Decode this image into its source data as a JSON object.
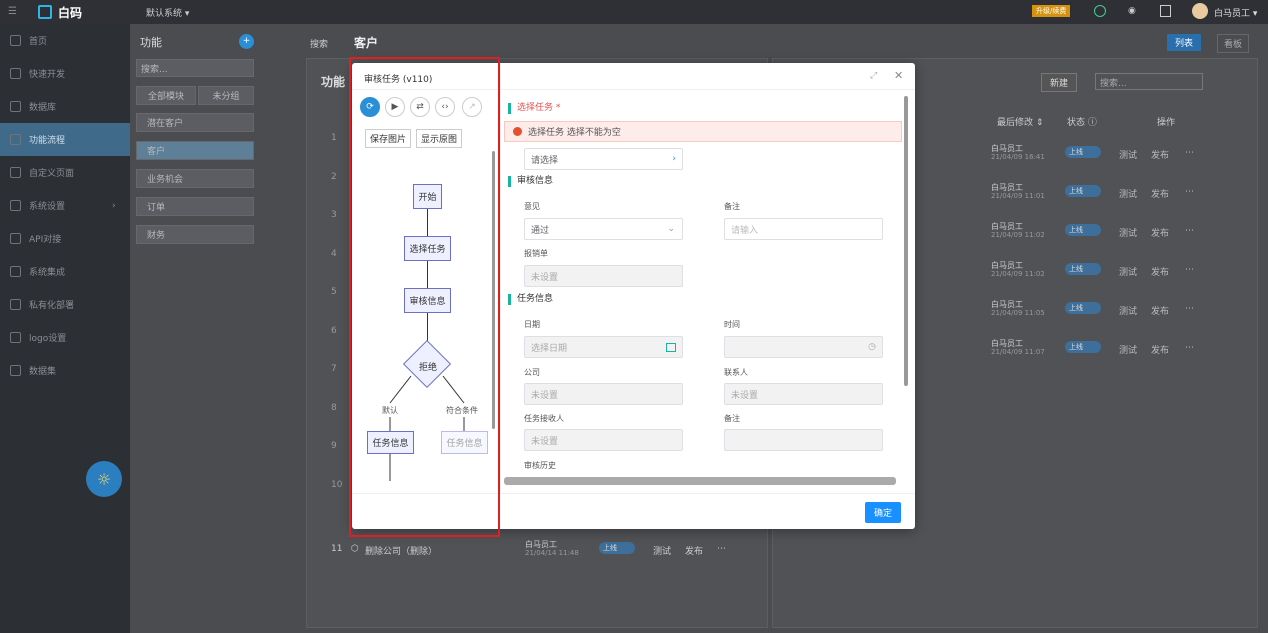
{
  "topbar": {
    "logo": "白码",
    "system": "默认系统 ▾",
    "upgrade": "升级/续费",
    "user": "白马员工 ▾"
  },
  "sidebar": {
    "items": [
      {
        "label": "首页"
      },
      {
        "label": "快速开发"
      },
      {
        "label": "数据库"
      },
      {
        "label": "功能流程"
      },
      {
        "label": "自定义页面"
      },
      {
        "label": "系统设置"
      },
      {
        "label": "API对接"
      },
      {
        "label": "系统集成"
      },
      {
        "label": "私有化部署"
      },
      {
        "label": "logo设置"
      },
      {
        "label": "数据集"
      }
    ]
  },
  "modules": {
    "title": "功能",
    "search_placeholder": "搜索...",
    "tab_all": "全部模块",
    "tab_ungrouped": "未分组",
    "items": [
      "潜在客户",
      "客户",
      "业务机会",
      "订单",
      "财务"
    ]
  },
  "main": {
    "search": "搜索",
    "title": "客户",
    "panel_title": "功能",
    "view_list": "列表",
    "view_board": "看板",
    "new_btn": "新建",
    "search_placeholder": "搜索...",
    "col_modified": "最后修改 ⇕",
    "col_status": "状态 ⓘ",
    "col_ops": "操作",
    "rows": [
      {
        "user": "白马员工",
        "time": "21/04/09 16:41"
      },
      {
        "user": "白马员工",
        "time": "21/04/09 11:01"
      },
      {
        "user": "白马员工",
        "time": "21/04/09 11:02"
      },
      {
        "user": "白马员工",
        "time": "21/04/09 11:02"
      },
      {
        "user": "白马员工",
        "time": "21/04/09 11:05"
      },
      {
        "user": "白马员工",
        "time": "21/04/09 11:07"
      }
    ],
    "status": "上线",
    "op_test": "测试",
    "op_publish": "发布",
    "row_numbers": [
      "1",
      "2",
      "3",
      "4",
      "5",
      "6",
      "7",
      "8",
      "9",
      "10"
    ],
    "row11": {
      "num": "11",
      "name": "删除公司（删除）",
      "user": "白马员工",
      "time": "21/04/14 11:48"
    }
  },
  "dialog": {
    "title": "审核任务 (v110)",
    "save_image": "保存图片",
    "show_original": "显示原图",
    "flow": {
      "start": "开始",
      "select": "选择任务",
      "review": "审核信息",
      "reject": "拒绝",
      "default": "默认",
      "match": "符合条件",
      "task1": "任务信息",
      "task2": "任务信息"
    },
    "form": {
      "select_task": "选择任务",
      "required": "*",
      "error": "选择任务 选择不能为空",
      "select_placeholder": "请选择",
      "sec_review": "审核信息",
      "opinion_label": "意见",
      "opinion_value": "通过",
      "remark_label": "备注",
      "remark_placeholder": "请输入",
      "reimburse_label": "报销单",
      "unset": "未设置",
      "sec_task": "任务信息",
      "date_label": "日期",
      "date_placeholder": "选择日期",
      "time_label": "时间",
      "company_label": "公司",
      "contact_label": "联系人",
      "receiver_label": "任务接收人",
      "remark2_label": "备注",
      "history_label": "审核历史"
    },
    "confirm": "确定"
  }
}
